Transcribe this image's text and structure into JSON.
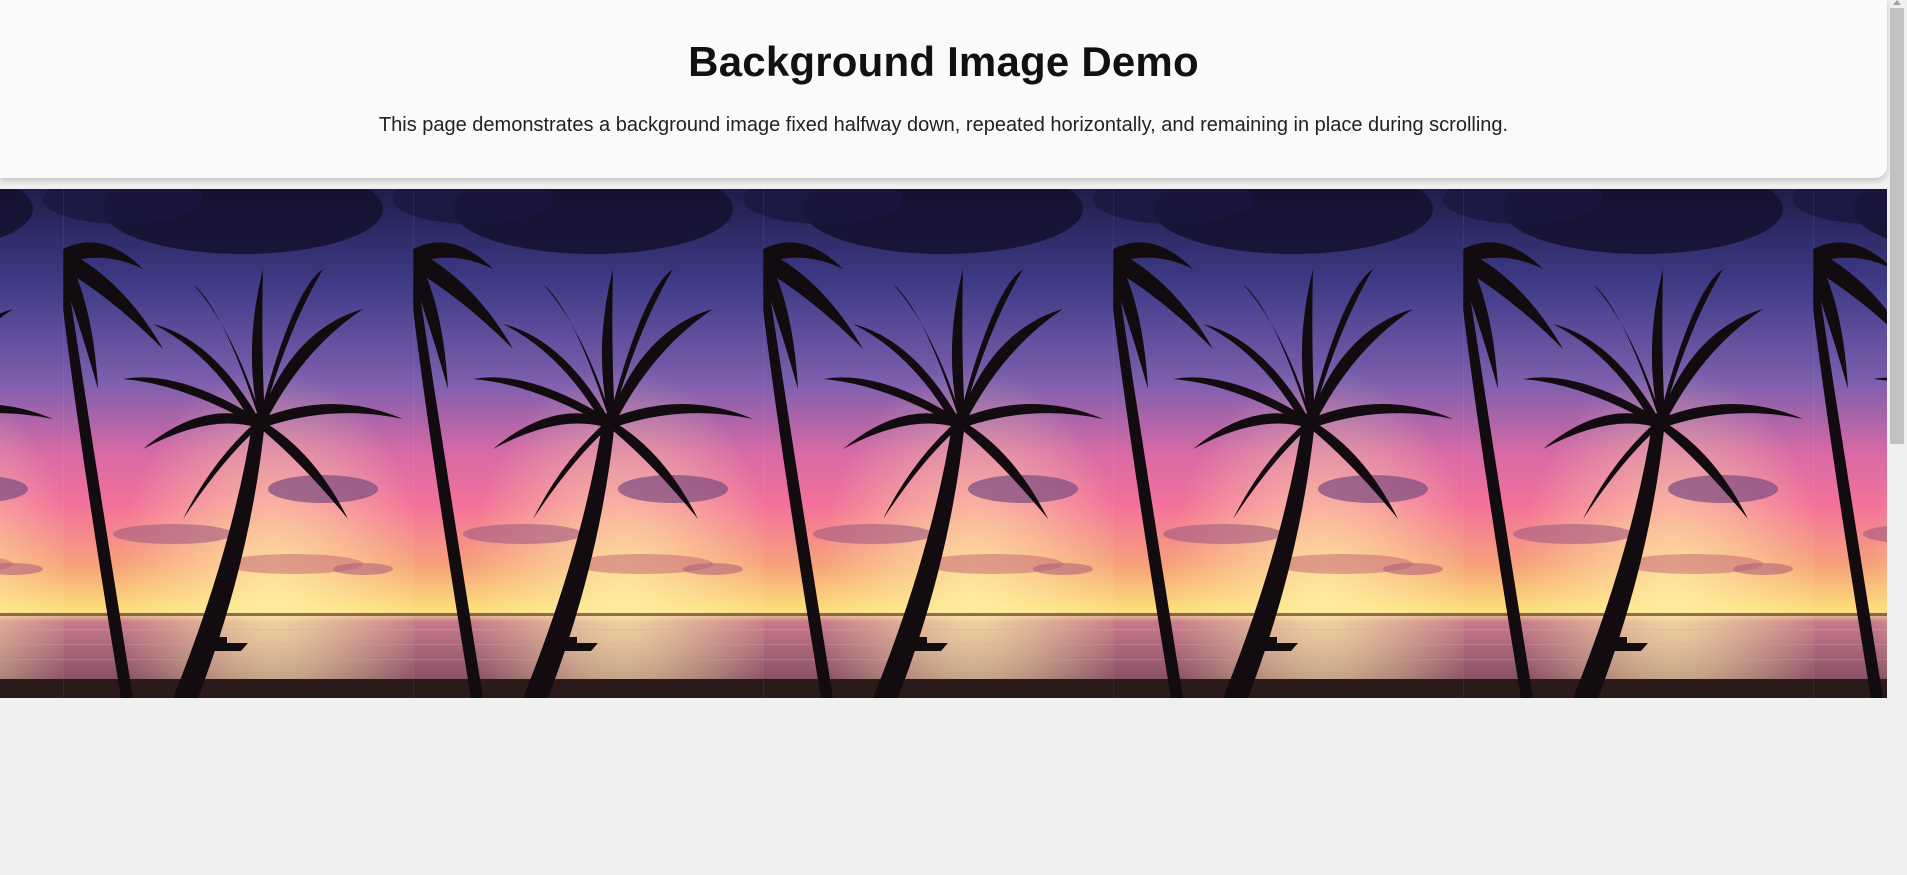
{
  "page": {
    "title": "Background Image Demo",
    "description": "This page demonstrates a background image fixed halfway down, repeated horizontally, and remaining in place during scrolling."
  },
  "background_image": {
    "subject": "palm trees silhouette at sunset over sea with boat",
    "repeat": "repeat-x",
    "colors": {
      "sky_top": "#1f1d4a",
      "sky_mid": "#7d5fae",
      "sky_pink": "#f3719b",
      "horizon": "#fde07a",
      "sea": "#c77a8c",
      "silhouette": "#120c10"
    }
  },
  "colors": {
    "page_bg": "#f0f0f0",
    "header_bg": "#fafafa",
    "text": "#111111"
  },
  "icons": [
    "scroll-up-arrow-icon"
  ]
}
